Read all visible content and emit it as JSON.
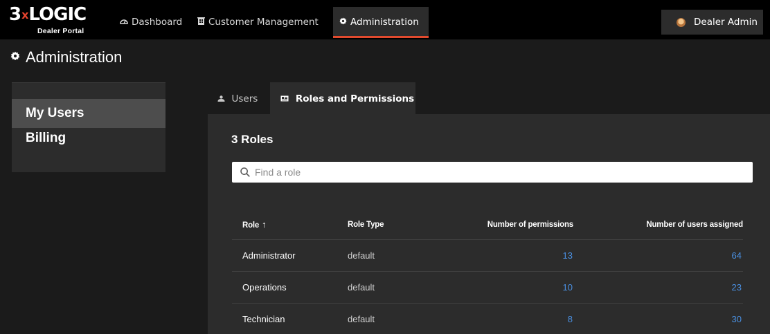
{
  "brand": {
    "logo_prefix": "3",
    "logo_x": "x",
    "logo_main": "LOGIC",
    "logo_sub": "Dealer Portal",
    "accent_color": "#e24a2e"
  },
  "topnav": {
    "items": [
      {
        "label": "Dashboard",
        "icon": "dashboard-icon"
      },
      {
        "label": "Customer Management",
        "icon": "building-icon"
      },
      {
        "label": "Administration",
        "icon": "gear-icon",
        "active": true
      }
    ],
    "user": {
      "name": "Dealer Admin",
      "icon": "avatar"
    }
  },
  "page": {
    "title": "Administration",
    "icon": "gear-icon"
  },
  "sidebar": {
    "items": [
      {
        "label": "My Users",
        "active": true
      },
      {
        "label": "Billing"
      }
    ]
  },
  "tabs": [
    {
      "label": "Users",
      "icon": "users-icon"
    },
    {
      "label": "Roles and Permissions",
      "icon": "id-card-icon",
      "active": true
    }
  ],
  "roles": {
    "count_label": "3 Roles",
    "search_placeholder": "Find a role",
    "columns": {
      "role": "Role",
      "role_sort": "↑",
      "type": "Role Type",
      "permissions": "Number of permissions",
      "users": "Number of users assigned"
    },
    "rows": [
      {
        "role": "Administrator",
        "type": "default",
        "permissions": "13",
        "users": "64"
      },
      {
        "role": "Operations",
        "type": "default",
        "permissions": "10",
        "users": "23"
      },
      {
        "role": "Technician",
        "type": "default",
        "permissions": "8",
        "users": "30"
      }
    ]
  }
}
